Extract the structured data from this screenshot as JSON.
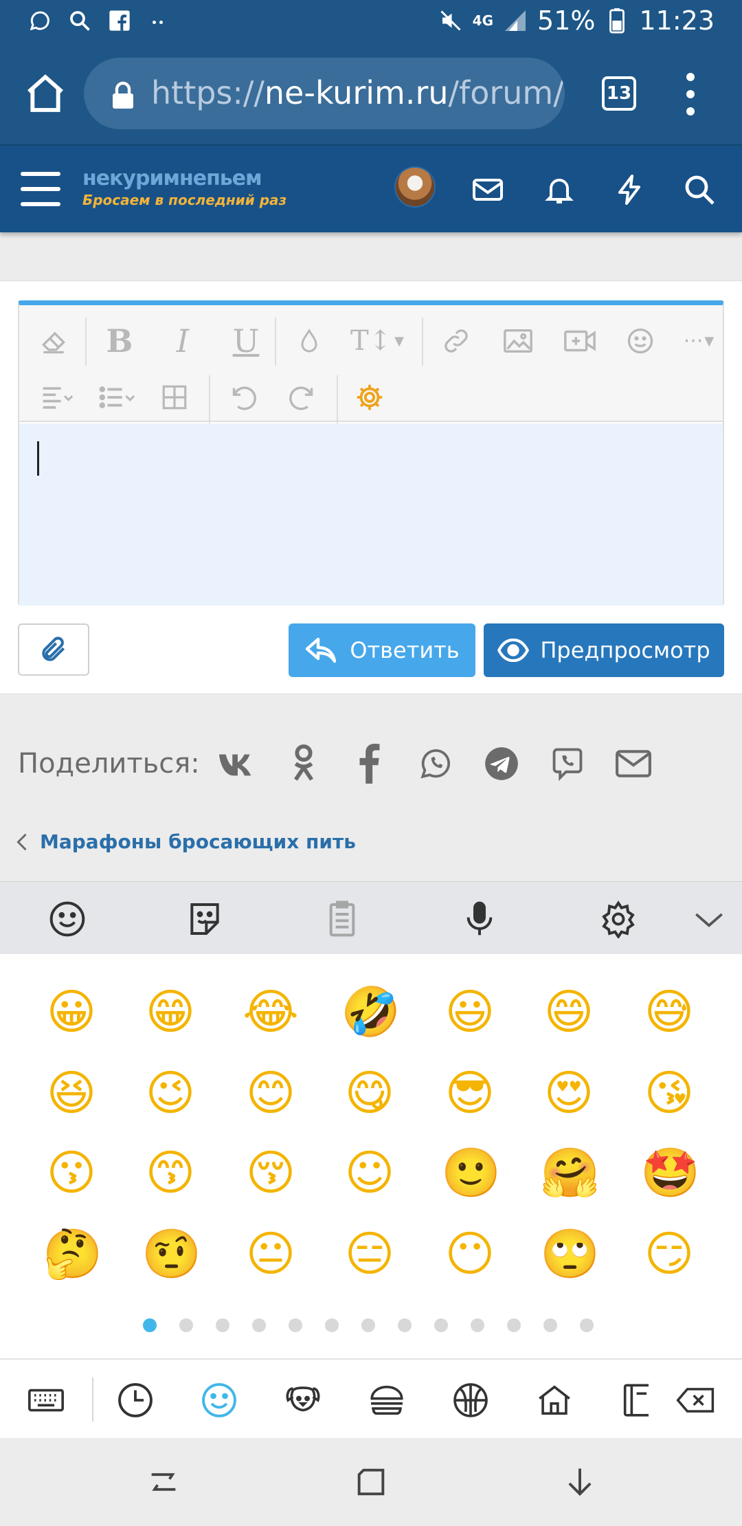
{
  "status_bar": {
    "battery": "51%",
    "time": "11:23",
    "network": "4G"
  },
  "browser": {
    "url_dim_prefix": "https://",
    "url_host": "ne-kurim.ru",
    "url_path": "/forum/th",
    "tab_count": "13"
  },
  "site_header": {
    "logo_line1": "некуримнепьем",
    "logo_line2": "Бросаем в последний раз"
  },
  "editor": {
    "row1_buttons": [
      "eraser-icon",
      "bold-icon",
      "italic-icon",
      "underline-icon",
      "color-icon",
      "text-size-icon",
      "link-icon",
      "image-icon",
      "video-icon",
      "smiley-icon",
      "more-icon"
    ],
    "row2_buttons": [
      "align-icon",
      "list-icon",
      "table-icon",
      "undo-icon",
      "redo-icon",
      "settings-icon"
    ],
    "bold_glyph": "B",
    "italic_glyph": "I",
    "underline_glyph": "U",
    "text_size_glyph": "T↕",
    "more_glyph": "···",
    "text_value": ""
  },
  "actions": {
    "reply_label": "Ответить",
    "preview_label": "Предпросмотр"
  },
  "share": {
    "label": "Поделиться:",
    "services": [
      "vk-icon",
      "ok-icon",
      "facebook-icon",
      "whatsapp-icon",
      "telegram-icon",
      "viber-icon",
      "email-icon"
    ]
  },
  "breadcrumb": {
    "label": "Марафоны бросающих пить"
  },
  "keyboard": {
    "emojis": [
      [
        "😀",
        "😁",
        "😂",
        "🤣",
        "😃",
        "😄",
        "😅"
      ],
      [
        "😆",
        "😉",
        "😊",
        "😋",
        "😎",
        "😍",
        "😘"
      ],
      [
        "😗",
        "😙",
        "😚",
        "☺",
        "🙂",
        "🤗",
        "🤩"
      ],
      [
        "🤔",
        "🤨",
        "😐",
        "😑",
        "😶",
        "🙄",
        "😏"
      ]
    ],
    "page_count": 13,
    "active_page": 1
  },
  "colors": {
    "brand_dark": "#185188",
    "accent_blue": "#47a7eb",
    "preview_blue": "#2777bc",
    "settings_orange": "#f0a31c",
    "keyboard_accent": "#40b7e8"
  }
}
